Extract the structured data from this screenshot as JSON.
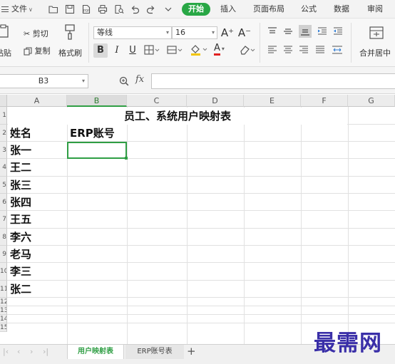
{
  "menu": {
    "file_label": "文件",
    "tabs": [
      "开始",
      "插入",
      "页面布局",
      "公式",
      "数据",
      "审阅"
    ]
  },
  "ribbon": {
    "paste": "粘贴",
    "cut": "剪切",
    "copy": "复制",
    "format_painter": "格式刷",
    "font_name": "等线",
    "font_size": "16",
    "grow_font": "A⁺",
    "shrink_font": "A⁻",
    "bold": "B",
    "italic": "I",
    "underline": "U",
    "font_color_letter": "A",
    "merge_center": "合并居中"
  },
  "formula_bar": {
    "name_box": "B3",
    "fx": "fx",
    "content": ""
  },
  "sheet": {
    "columns": [
      "A",
      "B",
      "C",
      "D",
      "E",
      "F",
      "G"
    ],
    "selected_column": "B",
    "rows": [
      "1",
      "2",
      "3",
      "4",
      "5",
      "6",
      "7",
      "8",
      "9",
      "10",
      "11",
      "12",
      "13",
      "14",
      "15"
    ],
    "title": "员工、系统用户映射表",
    "header_a": "姓名",
    "header_b": "ERP账号",
    "names": [
      "张一",
      "王二",
      "张三",
      "张四",
      "王五",
      "李六",
      "老马",
      "李三",
      "张二"
    ],
    "active_cell": "B3"
  },
  "sheet_tabs": {
    "tabs": [
      "用户映射表",
      "ERP账号表"
    ],
    "active": "用户映射表",
    "add": "+"
  },
  "watermark": "最需网",
  "colors": {
    "accent_green": "#28a745",
    "selection_green": "#2f9e44",
    "watermark": "#3a2fa8"
  }
}
